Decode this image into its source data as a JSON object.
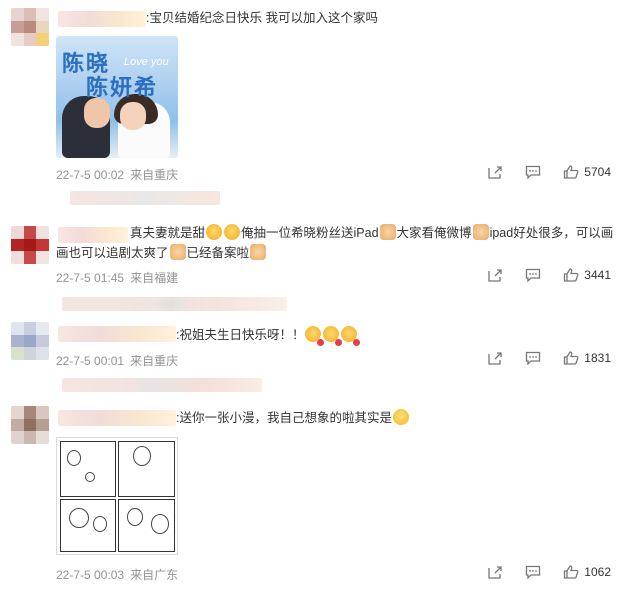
{
  "comments": [
    {
      "text": ":宝贝结婚纪念日快乐 我可以加入这个家吗",
      "image": {
        "line1": "陈晓",
        "line2": "陈妍希",
        "overlay": "Love you"
      },
      "date": "22-7-5 00:02",
      "source": "来自重庆",
      "likes": "5704"
    },
    {
      "text_parts": [
        "真夫妻就是甜",
        "俺抽一位希晓粉丝送iPad",
        "大家看俺微博",
        "ipad好处很多，可以画",
        "画也可以追剧太爽了",
        "已经备案啦"
      ],
      "date": "22-7-5 01:45",
      "source": "来自福建",
      "likes": "3441"
    },
    {
      "text": ":祝姐夫生日快乐呀！！",
      "date": "22-7-5 00:01",
      "source": "来自重庆",
      "likes": "1831"
    },
    {
      "text": ":送你一张小漫，我自己想象的啦其实是",
      "date": "22-7-5 00:03",
      "source": "来自广东",
      "likes": "1062"
    }
  ],
  "icons": {
    "share": "share-icon",
    "comment": "comment-icon",
    "like": "like-icon",
    "emoji_cry": "crying-emoji-icon",
    "emoji_fist": "fist-emoji-icon",
    "emoji_kiss": "kiss-emoji-icon",
    "emoji_grin": "grin-emoji-icon"
  },
  "colors": {
    "meta_text": "#939393",
    "body_text": "#333333",
    "title_blue": "#2a6fc2"
  }
}
